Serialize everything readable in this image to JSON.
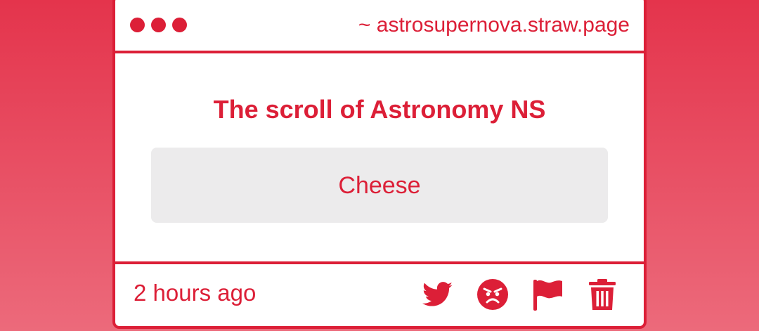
{
  "window": {
    "url": "~ astrosupernova.straw.page"
  },
  "post": {
    "title": "The scroll of Astronomy NS",
    "answer": "Cheese"
  },
  "footer": {
    "timestamp": "2 hours ago",
    "actions": [
      {
        "icon": "twitter-icon",
        "name": "share-twitter-button"
      },
      {
        "icon": "angry-face-icon",
        "name": "react-angry-button"
      },
      {
        "icon": "flag-icon",
        "name": "report-flag-button"
      },
      {
        "icon": "trash-icon",
        "name": "delete-button"
      }
    ]
  },
  "colors": {
    "accent": "#dc1f37",
    "background_top": "#e4344c",
    "background_bottom": "#ec6a7b",
    "card": "#ffffff",
    "answer_box": "#ecebec"
  }
}
